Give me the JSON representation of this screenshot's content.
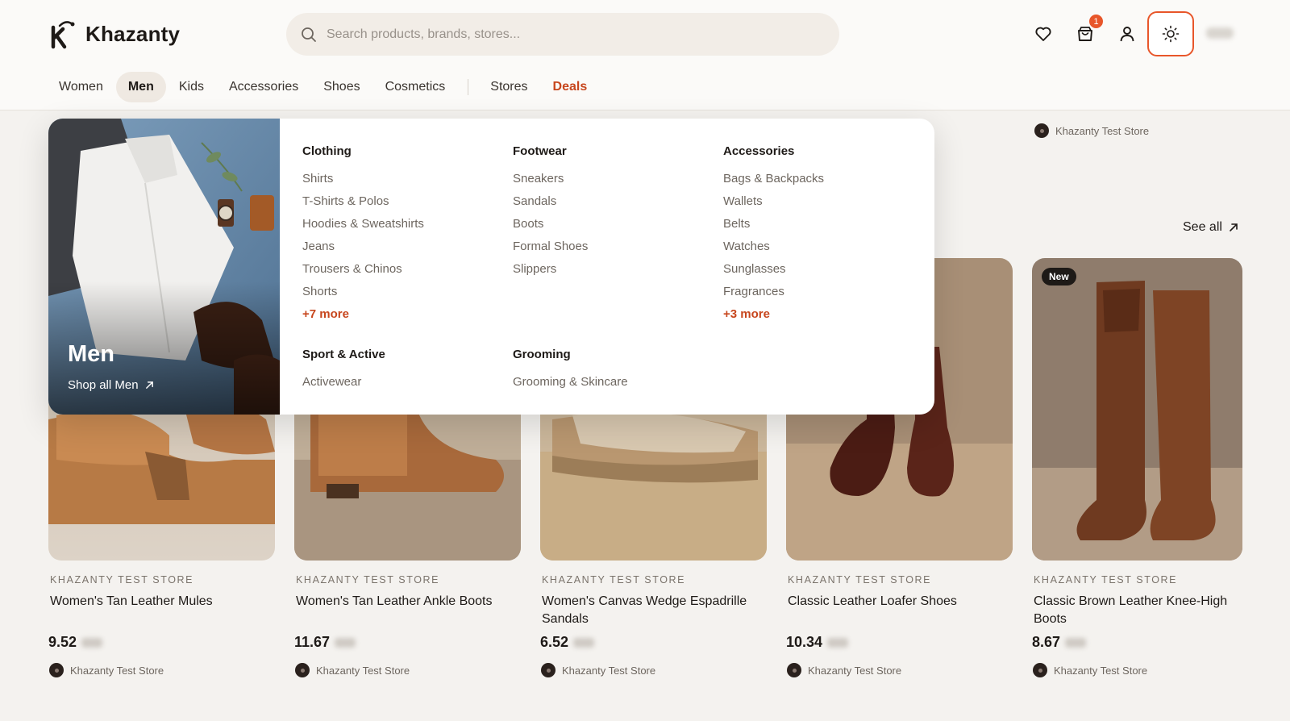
{
  "brand": {
    "name": "Khazanty",
    "accent": "#e8562a",
    "deals_color": "#c7461d"
  },
  "search": {
    "placeholder": "Search products, brands, stores..."
  },
  "header_icons": {
    "wishlist": "heart-icon",
    "cart": "shopping-bag-icon",
    "cart_count": "1",
    "account": "user-icon",
    "theme": "sun-icon"
  },
  "nav": {
    "items": [
      "Women",
      "Men",
      "Kids",
      "Accessories",
      "Shoes",
      "Cosmetics"
    ],
    "stores": "Stores",
    "deals": "Deals",
    "active": "Men"
  },
  "section": {
    "see_all": "See all",
    "top_store": "Khazanty Test Store"
  },
  "mega_menu": {
    "hero_title": "Men",
    "hero_link": "Shop all Men",
    "columns": [
      {
        "title": "Clothing",
        "items": [
          "Shirts",
          "T-Shirts & Polos",
          "Hoodies & Sweatshirts",
          "Jeans",
          "Trousers & Chinos",
          "Shorts"
        ],
        "more": "+7 more"
      },
      {
        "title": "Footwear",
        "items": [
          "Sneakers",
          "Sandals",
          "Boots",
          "Formal Shoes",
          "Slippers"
        ],
        "more": ""
      },
      {
        "title": "Accessories",
        "items": [
          "Bags & Backpacks",
          "Wallets",
          "Belts",
          "Watches",
          "Sunglasses",
          "Fragrances"
        ],
        "more": "+3 more"
      },
      {
        "title": "Sport & Active",
        "items": [
          "Activewear"
        ],
        "more": ""
      },
      {
        "title": "Grooming",
        "items": [
          "Grooming & Skincare"
        ],
        "more": ""
      }
    ]
  },
  "products": [
    {
      "store": "KHAZANTY TEST STORE",
      "name": "Women's Tan Leather Mules",
      "price": "9.52",
      "seller": "Khazanty Test Store",
      "badge": ""
    },
    {
      "store": "KHAZANTY TEST STORE",
      "name": "Women's Tan Leather Ankle Boots",
      "price": "11.67",
      "seller": "Khazanty Test Store",
      "badge": ""
    },
    {
      "store": "KHAZANTY TEST STORE",
      "name": "Women's Canvas Wedge Espadrille Sandals",
      "price": "6.52",
      "seller": "Khazanty Test Store",
      "badge": ""
    },
    {
      "store": "KHAZANTY TEST STORE",
      "name": "Classic Leather Loafer Shoes",
      "price": "10.34",
      "seller": "Khazanty Test Store",
      "badge": ""
    },
    {
      "store": "KHAZANTY TEST STORE",
      "name": "Classic Brown Leather Knee-High Boots",
      "price": "8.67",
      "seller": "Khazanty Test Store",
      "badge": "New"
    }
  ]
}
